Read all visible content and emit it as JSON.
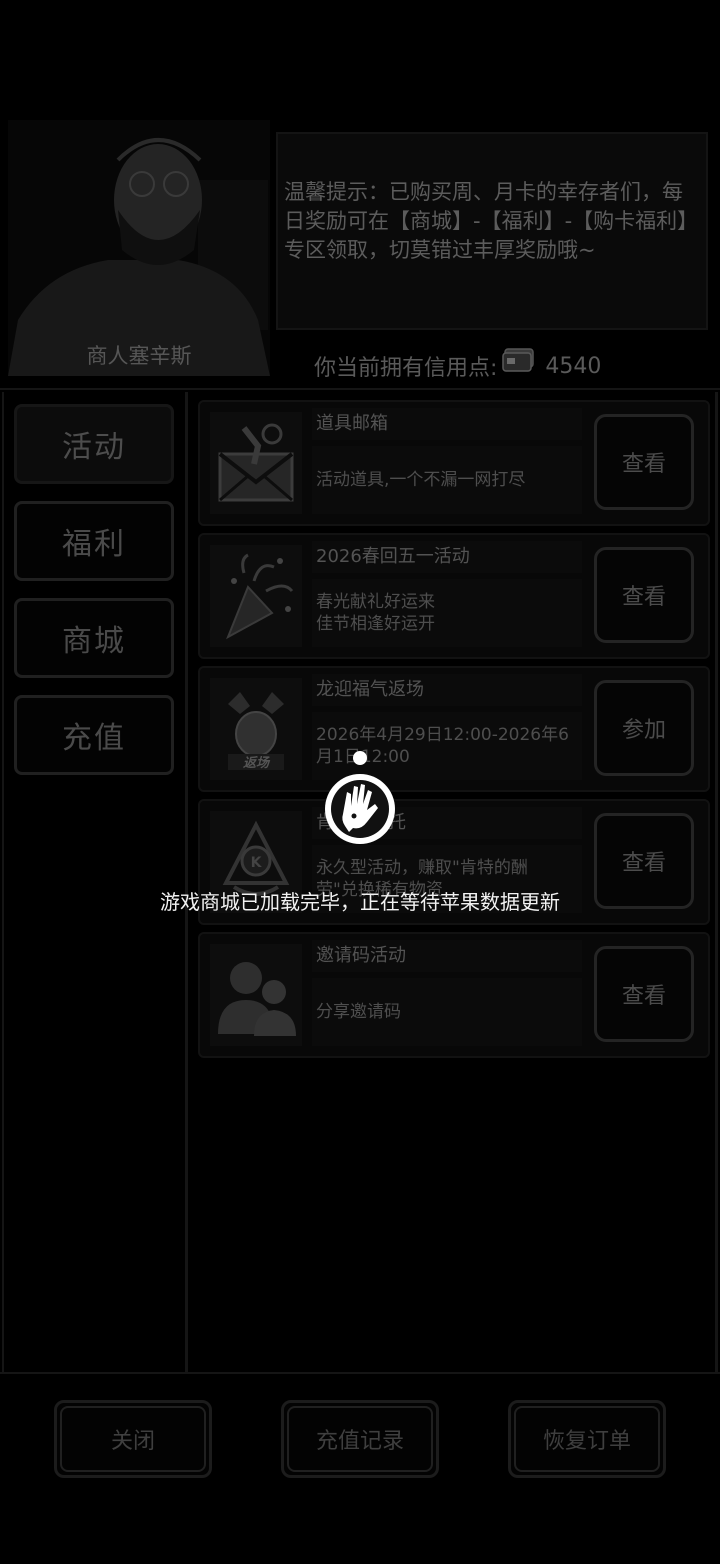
{
  "merchant": {
    "name": "商人塞辛斯"
  },
  "tip": {
    "text": "温馨提示：已购买周、月卡的幸存者们，每日奖励可在【商城】-【福利】-【购卡福利】专区领取，切莫错过丰厚奖励哦~"
  },
  "credits": {
    "label": "你当前拥有信用点:",
    "icon": "credit-card-icon",
    "value": "4540"
  },
  "nav": {
    "items": [
      {
        "label": "活动",
        "active": true
      },
      {
        "label": "福利",
        "active": false
      },
      {
        "label": "商城",
        "active": false
      },
      {
        "label": "充值",
        "active": false
      }
    ]
  },
  "items": [
    {
      "icon": "mail-pin-icon",
      "title": "道具邮箱",
      "desc": [
        "活动道具,一个不漏一网打尽"
      ],
      "button": "查看"
    },
    {
      "icon": "party-popper-icon",
      "title": "2026春回五一活动",
      "desc": [
        "春光献礼好运来",
        "佳节相逢好运开"
      ],
      "button": "查看"
    },
    {
      "icon": "lucky-bag-return-icon",
      "title": "龙迎福气返场",
      "desc": [
        "2026年4月29日12:00-2026年6月1日12:00"
      ],
      "button": "参加"
    },
    {
      "icon": "kent-emblem-icon",
      "title": "肯特的委托",
      "desc": [
        "永久型活动，赚取\"肯特的酬",
        "劳\"兑换稀有物资"
      ],
      "button": "查看"
    },
    {
      "icon": "users-icon",
      "title": "邀请码活动",
      "desc": [
        "分享邀请码"
      ],
      "button": "查看"
    }
  ],
  "bottom": {
    "close": "关闭",
    "recharge_history": "充值记录",
    "restore_order": "恢复订单"
  },
  "loading": {
    "text": "游戏商城已加载完毕，正在等待苹果数据更新",
    "icon": "zombie-hand-logo-icon"
  }
}
